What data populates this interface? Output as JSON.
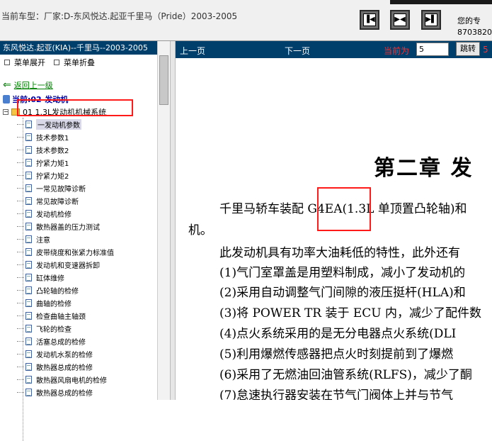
{
  "topbar": {
    "current_model": "当前车型：厂家:D-东风悦达.起亚千里马（Pride）2003-2005",
    "contact_line1": "您的专",
    "contact_line2": "8703820",
    "buttons": [
      {
        "name": "prev-page-tool",
        "glyph": "▐◀"
      },
      {
        "name": "split-view-tool",
        "glyph": "▶◀"
      },
      {
        "name": "next-page-tool",
        "glyph": "▶▌"
      }
    ]
  },
  "left_panel": {
    "header": "东风悦达.起亚(KIA)--千里马--2003-2005",
    "menu_expand": "菜单展开",
    "menu_collapse": "菜单折叠",
    "back_label": "返回上一级",
    "current_section": "当前:02-发动机",
    "folder_label": "01  1.3L发动机机械系统",
    "items": [
      "一发动机参数",
      "技术参数1",
      "技术参数2",
      "拧紧力矩1",
      "拧紧力矩2",
      "一常见故障诊断",
      "常见故障诊断",
      "发动机检修",
      "散热器盖的压力测试",
      "注意",
      "皮带绕度和张紧力标准值",
      "发动机和变速器拆卸",
      "缸体维修",
      "凸轮轴的检修",
      "曲轴的检修",
      "检查曲轴主轴颈",
      "飞轮的检查",
      "活塞总成的检修",
      "发动机水泵的检修",
      "散热器总成的检修",
      "散热器风扇电机的检修",
      "散热器总成的检修"
    ]
  },
  "right_panel": {
    "prev_label": "上一页",
    "next_label": "下一页",
    "current_label": "当前为",
    "page_value": "5",
    "jump_label": "跳转",
    "total_pages": "5"
  },
  "document": {
    "chapter_title": "第二章   发",
    "lines": [
      "千里马轿车装配 G4EA(1.3L 单顶置凸轮轴)和",
      "机。",
      "此发动机具有功率大油耗低的特性，此外还有",
      "(1)气门室罩盖是用塑料制成，减小了发动机的",
      "(2)采用自动调整气门间隙的液压挺杆(HLA)和",
      "(3)将 POWER TR 装于 ECU 内，减少了配件数",
      "(4)点火系统采用的是无分电器点火系统(DLI",
      "(5)利用爆燃传感器把点火时刻提前到了爆燃",
      "(6)采用了无燃油回油管系统(RLFS)，减少了酮",
      "(7)怠速执行器安装在节气门阀体上并与节气"
    ]
  },
  "colors": {
    "header_bg": "#003e6b",
    "highlight_box": "#ff1a1a",
    "page_indicator": "#ff3030"
  }
}
